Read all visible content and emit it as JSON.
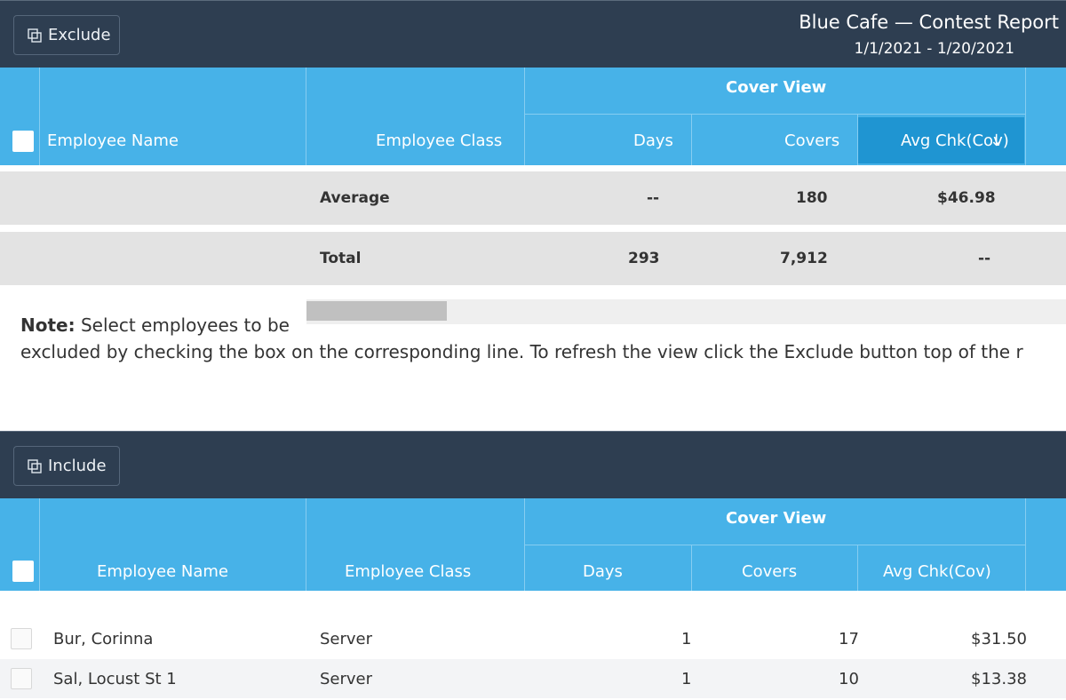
{
  "exclude_panel": {
    "button_label": "Exclude",
    "title": "Blue Cafe — Contest Report",
    "date_range": "1/1/2021 - 1/20/2021",
    "group_header": "Cover View",
    "columns": {
      "name": "Employee Name",
      "class": "Employee Class",
      "days": "Days",
      "covers": "Covers",
      "avg": "Avg Chk(Cov)",
      "sort_indicator": "↓"
    },
    "average": {
      "label": "Average",
      "days": "--",
      "covers": "180",
      "avg": "$46.98"
    },
    "total": {
      "label": "Total",
      "days": "293",
      "covers": "7,912",
      "avg": "--"
    }
  },
  "note": {
    "label": "Note:",
    "line1": "Select employees to be",
    "line2": "excluded by checking the box on the corresponding line. To refresh the view click the Exclude button top of the r"
  },
  "include_panel": {
    "button_label": "Include",
    "group_header": "Cover View",
    "columns": {
      "name": "Employee Name",
      "class": "Employee Class",
      "days": "Days",
      "covers": "Covers",
      "avg": "Avg Chk(Cov)"
    },
    "rows": [
      {
        "name": "Bur, Corinna",
        "class": "Server",
        "days": "1",
        "covers": "17",
        "avg": "$31.50"
      },
      {
        "name": "Sal, Locust St 1",
        "class": "Server",
        "days": "1",
        "covers": "10",
        "avg": "$13.38"
      }
    ]
  },
  "icons": {
    "exclude": "copy-icon",
    "include": "copy-icon",
    "sort": "arrow-down-icon"
  }
}
